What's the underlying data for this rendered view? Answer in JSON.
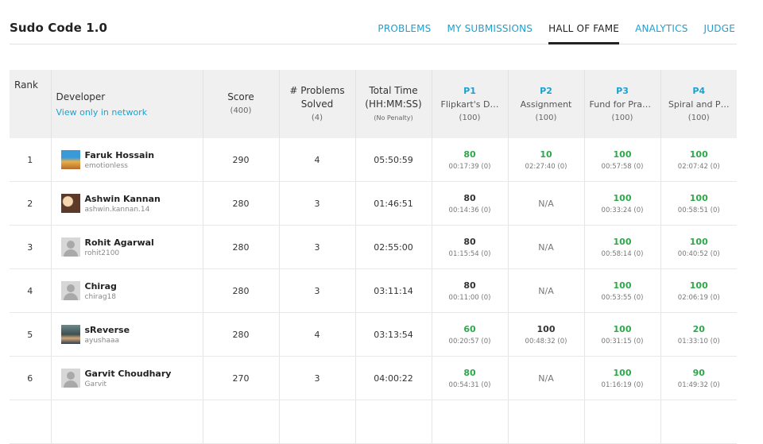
{
  "app": {
    "title": "Sudo Code 1.0"
  },
  "nav": [
    {
      "label": "PROBLEMS",
      "active": false
    },
    {
      "label": "MY SUBMISSIONS",
      "active": false
    },
    {
      "label": "HALL OF FAME",
      "active": true
    },
    {
      "label": "ANALYTICS",
      "active": false
    },
    {
      "label": "JUDGE",
      "active": false
    }
  ],
  "table": {
    "rank_header": "Rank",
    "developer_header": "Developer",
    "network_link": "View only in network",
    "score_header": "Score",
    "score_max": "(400)",
    "problems_header_1": "# Problems",
    "problems_header_2": "Solved",
    "problems_max": "(4)",
    "time_header_1": "Total Time",
    "time_header_2": "(HH:MM:SS)",
    "time_note": "(No Penalty)",
    "problems": [
      {
        "code": "P1",
        "name": "Flipkart's D…",
        "max": "(100)"
      },
      {
        "code": "P2",
        "name": "Assignment",
        "max": "(100)"
      },
      {
        "code": "P3",
        "name": "Fund for Prayas",
        "max": "(100)"
      },
      {
        "code": "P4",
        "name": "Spiral and P…",
        "max": "(100)"
      }
    ],
    "rows": [
      {
        "rank": "1",
        "name": "Faruk Hossain",
        "username": "emotionless",
        "avatar": "photo",
        "score": "290",
        "solved": "4",
        "time": "05:50:59",
        "p": [
          {
            "score": "80",
            "time": "00:17:39 (0)"
          },
          {
            "score": "10",
            "time": "02:27:40 (0)"
          },
          {
            "score": "100",
            "time": "00:57:58 (0)"
          },
          {
            "score": "100",
            "time": "02:07:42 (0)"
          }
        ]
      },
      {
        "rank": "2",
        "name": "Ashwin Kannan",
        "username": "ashwin.kannan.14",
        "avatar": "photo",
        "score": "280",
        "solved": "3",
        "time": "01:46:51",
        "p": [
          {
            "score": "80",
            "time": "00:14:36 (0)"
          },
          {
            "na": "N/A"
          },
          {
            "score": "100",
            "time": "00:33:24 (0)"
          },
          {
            "score": "100",
            "time": "00:58:51 (0)"
          }
        ]
      },
      {
        "rank": "3",
        "name": "Rohit Agarwal",
        "username": "rohit2100",
        "avatar": "generic",
        "score": "280",
        "solved": "3",
        "time": "02:55:00",
        "p": [
          {
            "score": "80",
            "time": "01:15:54 (0)"
          },
          {
            "na": "N/A"
          },
          {
            "score": "100",
            "time": "00:58:14 (0)"
          },
          {
            "score": "100",
            "time": "00:40:52 (0)"
          }
        ]
      },
      {
        "rank": "4",
        "name": "Chirag",
        "username": "chirag18",
        "avatar": "generic",
        "score": "280",
        "solved": "3",
        "time": "03:11:14",
        "p": [
          {
            "score": "80",
            "time": "00:11:00 (0)"
          },
          {
            "na": "N/A"
          },
          {
            "score": "100",
            "time": "00:53:55 (0)"
          },
          {
            "score": "100",
            "time": "02:06:19 (0)"
          }
        ]
      },
      {
        "rank": "5",
        "name": "sReverse",
        "username": "ayushaaa",
        "avatar": "photo",
        "score": "280",
        "solved": "4",
        "time": "03:13:54",
        "p": [
          {
            "score": "60",
            "time": "00:20:57 (0)"
          },
          {
            "score": "100",
            "time": "00:48:32 (0)"
          },
          {
            "score": "100",
            "time": "00:31:15 (0)"
          },
          {
            "score": "20",
            "time": "01:33:10 (0)"
          }
        ]
      },
      {
        "rank": "6",
        "name": "Garvit Choudhary",
        "username": "Garvit",
        "avatar": "generic",
        "score": "270",
        "solved": "3",
        "time": "04:00:22",
        "p": [
          {
            "score": "80",
            "time": "00:54:31 (0)"
          },
          {
            "na": "N/A"
          },
          {
            "score": "100",
            "time": "01:16:19 (0)"
          },
          {
            "score": "90",
            "time": "01:49:32 (0)"
          }
        ]
      }
    ]
  },
  "colors": {
    "accent": "#1ba1d1",
    "full_score": "#2da84a",
    "partial_score": "#333333"
  }
}
